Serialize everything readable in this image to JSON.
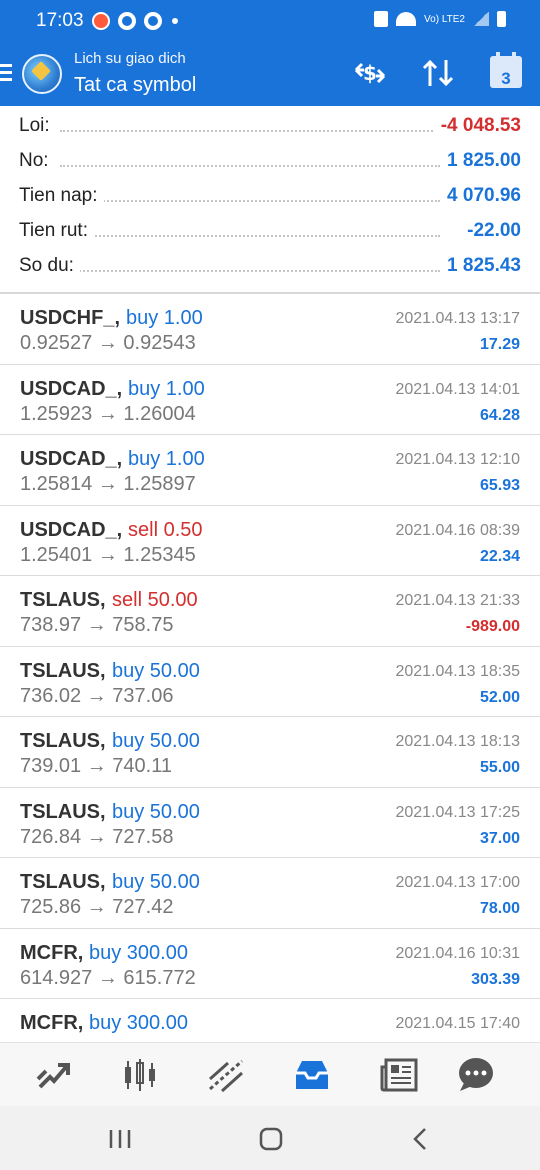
{
  "status_bar": {
    "time": "17:03",
    "network_text": "Vo) LTE2"
  },
  "header": {
    "subtitle": "Lich su giao dich",
    "title": "Tat ca symbol",
    "calendar_day": "3",
    "accent_color": "#1a73d9"
  },
  "summary": [
    {
      "label": "Loi:",
      "value": "-4 048.53",
      "tone": "neg"
    },
    {
      "label": "No:",
      "value": "1 825.00",
      "tone": "pos"
    },
    {
      "label": "Tien nap:",
      "value": "4 070.96",
      "tone": "pos"
    },
    {
      "label": "Tien rut:",
      "value": "-22.00",
      "tone": "pos"
    },
    {
      "label": "So du:",
      "value": "1 825.43",
      "tone": "pos"
    }
  ],
  "deals": [
    {
      "symbol": "USDCHF_,",
      "side": "buy 1.00",
      "side_type": "buy",
      "prices": "0.92527 → 0.92543",
      "date": "2021.04.13 13:17",
      "profit": "17.29",
      "profit_type": "pos"
    },
    {
      "symbol": "USDCAD_,",
      "side": "buy 1.00",
      "side_type": "buy",
      "prices": "1.25923 → 1.26004",
      "date": "2021.04.13 14:01",
      "profit": "64.28",
      "profit_type": "pos"
    },
    {
      "symbol": "USDCAD_,",
      "side": "buy 1.00",
      "side_type": "buy",
      "prices": "1.25814 → 1.25897",
      "date": "2021.04.13 12:10",
      "profit": "65.93",
      "profit_type": "pos"
    },
    {
      "symbol": "USDCAD_,",
      "side": "sell 0.50",
      "side_type": "sell",
      "prices": "1.25401 → 1.25345",
      "date": "2021.04.16 08:39",
      "profit": "22.34",
      "profit_type": "pos"
    },
    {
      "symbol": "TSLAUS,",
      "side": "sell 50.00",
      "side_type": "sell",
      "prices": "738.97 → 758.75",
      "date": "2021.04.13 21:33",
      "profit": "-989.00",
      "profit_type": "neg"
    },
    {
      "symbol": "TSLAUS,",
      "side": "buy 50.00",
      "side_type": "buy",
      "prices": "736.02 → 737.06",
      "date": "2021.04.13 18:35",
      "profit": "52.00",
      "profit_type": "pos"
    },
    {
      "symbol": "TSLAUS,",
      "side": "buy 50.00",
      "side_type": "buy",
      "prices": "739.01 → 740.11",
      "date": "2021.04.13 18:13",
      "profit": "55.00",
      "profit_type": "pos"
    },
    {
      "symbol": "TSLAUS,",
      "side": "buy 50.00",
      "side_type": "buy",
      "prices": "726.84 → 727.58",
      "date": "2021.04.13 17:25",
      "profit": "37.00",
      "profit_type": "pos"
    },
    {
      "symbol": "TSLAUS,",
      "side": "buy 50.00",
      "side_type": "buy",
      "prices": "725.86 → 727.42",
      "date": "2021.04.13 17:00",
      "profit": "78.00",
      "profit_type": "pos"
    },
    {
      "symbol": "MCFR,",
      "side": "buy 300.00",
      "side_type": "buy",
      "prices": "614.927 → 615.772",
      "date": "2021.04.16 10:31",
      "profit": "303.39",
      "profit_type": "pos"
    },
    {
      "symbol": "MCFR,",
      "side": "buy 300.00",
      "side_type": "buy",
      "prices": "",
      "date": "2021.04.15 17:40",
      "profit": "",
      "profit_type": "pos"
    }
  ],
  "bottom_nav": [
    {
      "icon": "quotes-icon",
      "active": false
    },
    {
      "icon": "chart-icon",
      "active": false
    },
    {
      "icon": "trade-icon",
      "active": false
    },
    {
      "icon": "history-icon",
      "active": true
    },
    {
      "icon": "news-icon",
      "active": false
    },
    {
      "icon": "messages-icon",
      "active": false
    }
  ],
  "system_nav": [
    {
      "icon": "recent-apps-icon"
    },
    {
      "icon": "home-icon"
    },
    {
      "icon": "back-icon"
    }
  ],
  "colors": {
    "buy": "#1a73d9",
    "sell": "#d32f2f",
    "positive_profit": "#1a73d9",
    "negative_profit": "#d32f2f"
  }
}
